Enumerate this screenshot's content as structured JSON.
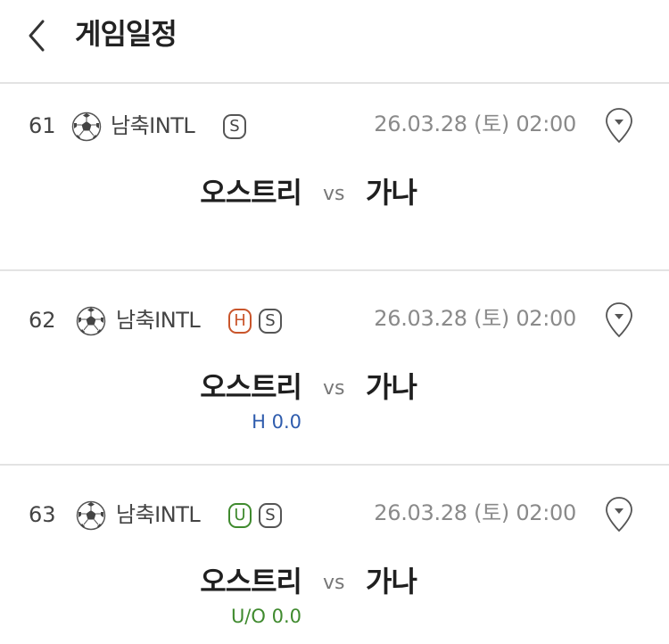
{
  "header": {
    "title": "게임일정",
    "back_icon": "chevron-left-icon"
  },
  "matches": [
    {
      "number": "61",
      "league": "남축INTL",
      "badges": [
        "S"
      ],
      "datetime": "26.03.28 (토) 02:00",
      "home": "오스트리",
      "vs": "vs",
      "away": "가나",
      "handicap": ""
    },
    {
      "number": "62",
      "league": "남축INTL",
      "badges": [
        "H",
        "S"
      ],
      "datetime": "26.03.28 (토) 02:00",
      "home": "오스트리",
      "vs": "vs",
      "away": "가나",
      "handicap": "H 0.0"
    },
    {
      "number": "63",
      "league": "남축INTL",
      "badges": [
        "U",
        "S"
      ],
      "datetime": "26.03.28 (토) 02:00",
      "home": "오스트리",
      "vs": "vs",
      "away": "가나",
      "handicap": "U/O 0.0"
    }
  ],
  "colors": {
    "handicap_badge": "#c9552b",
    "handicap_text": "#2f5cad",
    "underover": "#3f8a2e",
    "divider": "#e3e3e3"
  }
}
